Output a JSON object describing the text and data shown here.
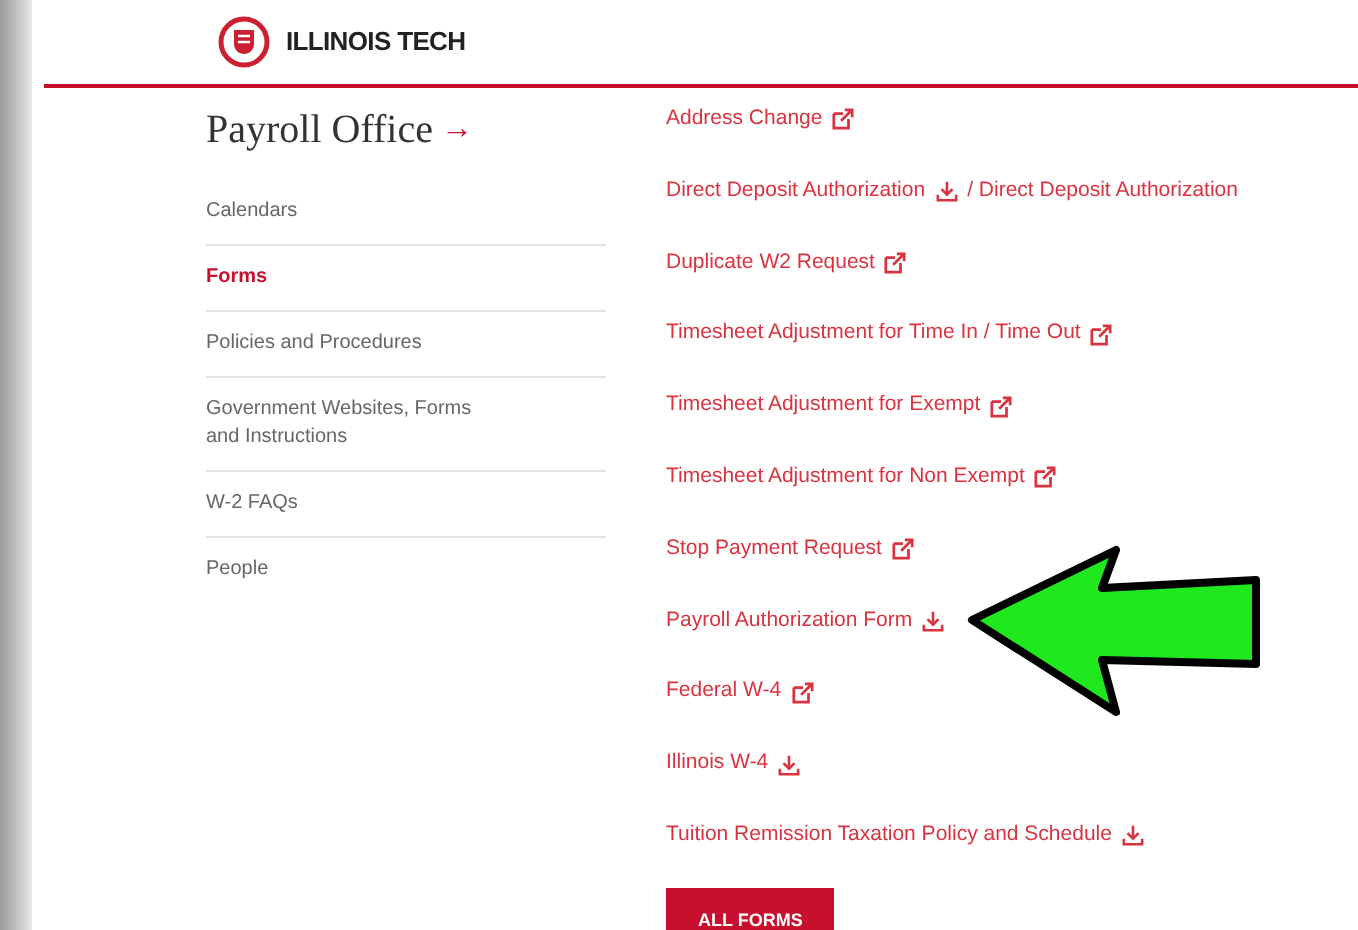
{
  "header": {
    "logo_text": "ILLINOIS TECH"
  },
  "sidebar": {
    "title": "Payroll Office",
    "title_arrow": "→",
    "items": [
      {
        "label": "Calendars",
        "selected": false
      },
      {
        "label": "Forms",
        "selected": true
      },
      {
        "label": "Policies and Procedures",
        "selected": false
      },
      {
        "label": "Government Websites, Forms and Instructions",
        "selected": false
      },
      {
        "label": "W-2 FAQs",
        "selected": false
      },
      {
        "label": "People",
        "selected": false
      }
    ]
  },
  "forms": [
    {
      "parts": [
        {
          "label": "Address Change",
          "kind": "external"
        }
      ]
    },
    {
      "parts": [
        {
          "label": "Direct Deposit Authorization",
          "kind": "download"
        },
        {
          "label": "/ Direct Deposit Authorization",
          "kind": "plain"
        }
      ]
    },
    {
      "parts": [
        {
          "label": "Duplicate W2 Request",
          "kind": "external"
        }
      ]
    },
    {
      "parts": [
        {
          "label": "Timesheet Adjustment for Time In / Time Out",
          "kind": "external"
        }
      ]
    },
    {
      "parts": [
        {
          "label": "Timesheet Adjustment for Exempt",
          "kind": "external"
        }
      ]
    },
    {
      "parts": [
        {
          "label": "Timesheet Adjustment for Non Exempt",
          "kind": "external"
        }
      ]
    },
    {
      "parts": [
        {
          "label": "Stop Payment Request",
          "kind": "external"
        }
      ]
    },
    {
      "parts": [
        {
          "label": "Payroll Authorization Form",
          "kind": "download"
        }
      ]
    },
    {
      "parts": [
        {
          "label": "Federal W-4",
          "kind": "external"
        }
      ]
    },
    {
      "parts": [
        {
          "label": "Illinois W-4",
          "kind": "download"
        }
      ]
    },
    {
      "parts": [
        {
          "label": "Tuition Remission Taxation Policy and Schedule",
          "kind": "download"
        }
      ]
    }
  ],
  "all_forms_button": "ALL FORMS",
  "annotation": {
    "kind": "arrow"
  }
}
